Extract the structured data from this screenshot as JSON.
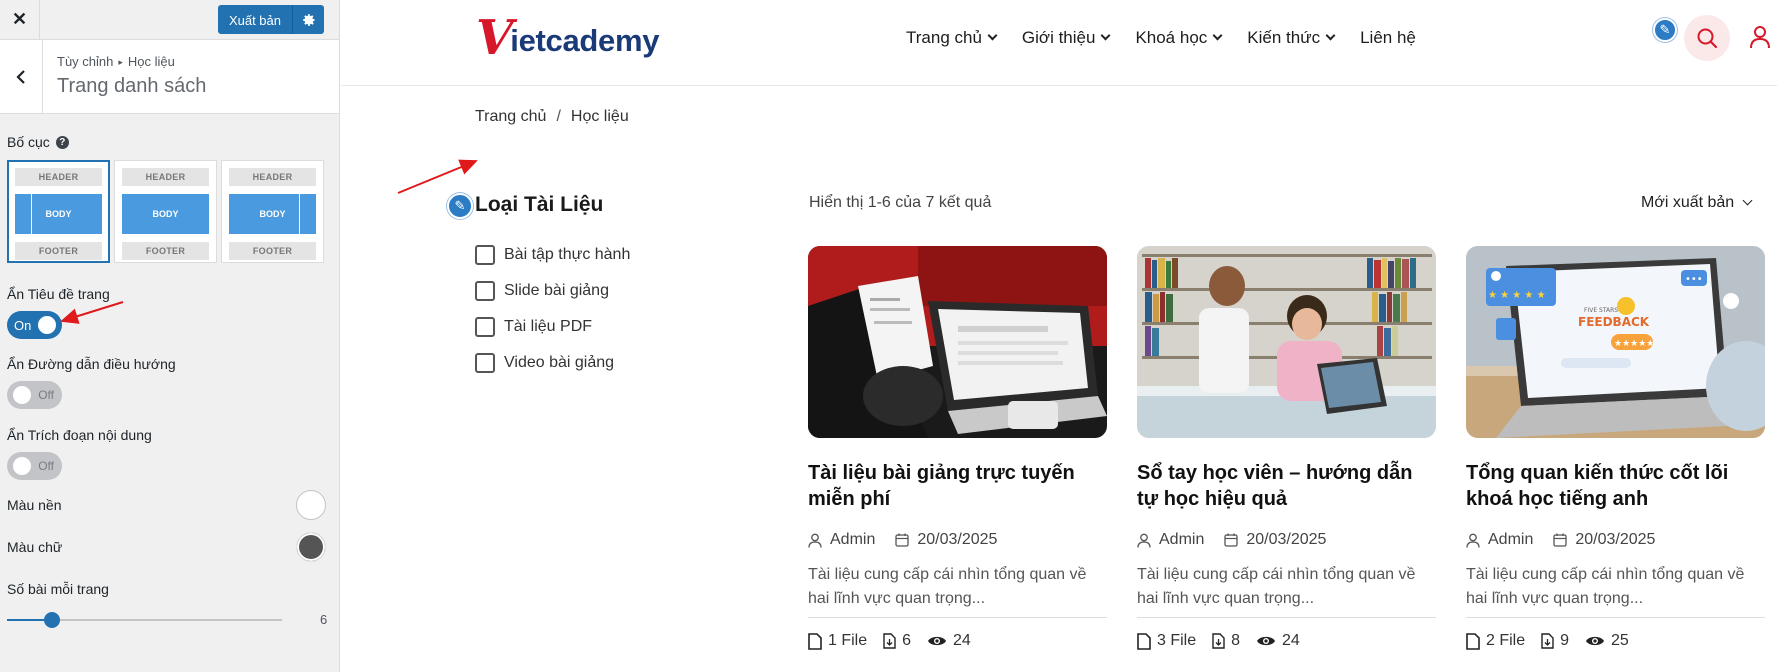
{
  "customizer": {
    "close_label": "✕",
    "publish_label": "Xuất bản",
    "breadcrumb_parent": "Tùy chỉnh",
    "breadcrumb_current": "Học liệu",
    "section_title": "Trang danh sách",
    "layout_label": "Bố cục",
    "layouts": [
      {
        "header": "HEADER",
        "body": "BODY",
        "footer": "FOOTER",
        "selected": true
      },
      {
        "header": "HEADER",
        "body": "BODY",
        "footer": "FOOTER",
        "selected": false
      },
      {
        "header": "HEADER",
        "body": "BODY",
        "footer": "FOOTER",
        "selected": false
      }
    ],
    "hide_page_title": {
      "label": "Ẩn Tiêu đề trang",
      "state": "On"
    },
    "hide_breadcrumb": {
      "label": "Ẩn Đường dẫn điều hướng",
      "state": "Off"
    },
    "hide_excerpt": {
      "label": "Ẩn Trích đoạn nội dung",
      "state": "Off"
    },
    "bg_color": {
      "label": "Màu nền",
      "value": "#ffffff"
    },
    "text_color": {
      "label": "Màu chữ",
      "value": "#555555"
    },
    "posts_per_page": {
      "label": "Số bài mỗi trang",
      "value": "6"
    }
  },
  "site": {
    "logo_v": "V",
    "logo_rest": "ietcademy",
    "nav": [
      {
        "label": "Trang chủ",
        "dropdown": true
      },
      {
        "label": "Giới thiệu",
        "dropdown": true
      },
      {
        "label": "Khoá học",
        "dropdown": true
      },
      {
        "label": "Kiến thức",
        "dropdown": true
      },
      {
        "label": "Liên hệ",
        "dropdown": false
      }
    ],
    "breadcrumb": {
      "home": "Trang chủ",
      "sep": "/",
      "current": "Học liệu"
    },
    "filter": {
      "title": "Loại Tài Liệu",
      "items": [
        "Bài tập thực hành",
        "Slide bài giảng",
        "Tài liệu PDF",
        "Video bài giảng"
      ]
    },
    "result_count": "Hiển thị 1-6 của 7 kết quả",
    "sort_label": "Mới xuất bản",
    "cards": [
      {
        "title": "Tài liệu bài giảng trực tuyến miễn phí",
        "author": "Admin",
        "date": "20/03/2025",
        "excerpt": "Tài liệu cung cấp cái nhìn tổng quan về hai lĩnh vực quan trọng...",
        "files": "1 File",
        "downloads": "6",
        "views": "24"
      },
      {
        "title": "Sổ tay học viên – hướng dẫn tự học hiệu quả",
        "author": "Admin",
        "date": "20/03/2025",
        "excerpt": "Tài liệu cung cấp cái nhìn tổng quan về hai lĩnh vực quan trọng...",
        "files": "3 File",
        "downloads": "8",
        "views": "24"
      },
      {
        "title": "Tổng quan kiến thức cốt lõi khoá học tiếng anh",
        "author": "Admin",
        "date": "20/03/2025",
        "excerpt": "Tài liệu cung cấp cái nhìn tổng quan về hai lĩnh vực quan trọng...",
        "files": "2 File",
        "downloads": "9",
        "views": "25"
      }
    ],
    "thumb_feedback_text": "FEEDBACK",
    "thumb_five_stars_text": "FIVE STARS"
  },
  "colors": {
    "wp_blue": "#2271b1",
    "brand_red": "#d7182a",
    "brand_navy": "#1a3a78",
    "annotation_red": "#e0191b"
  }
}
